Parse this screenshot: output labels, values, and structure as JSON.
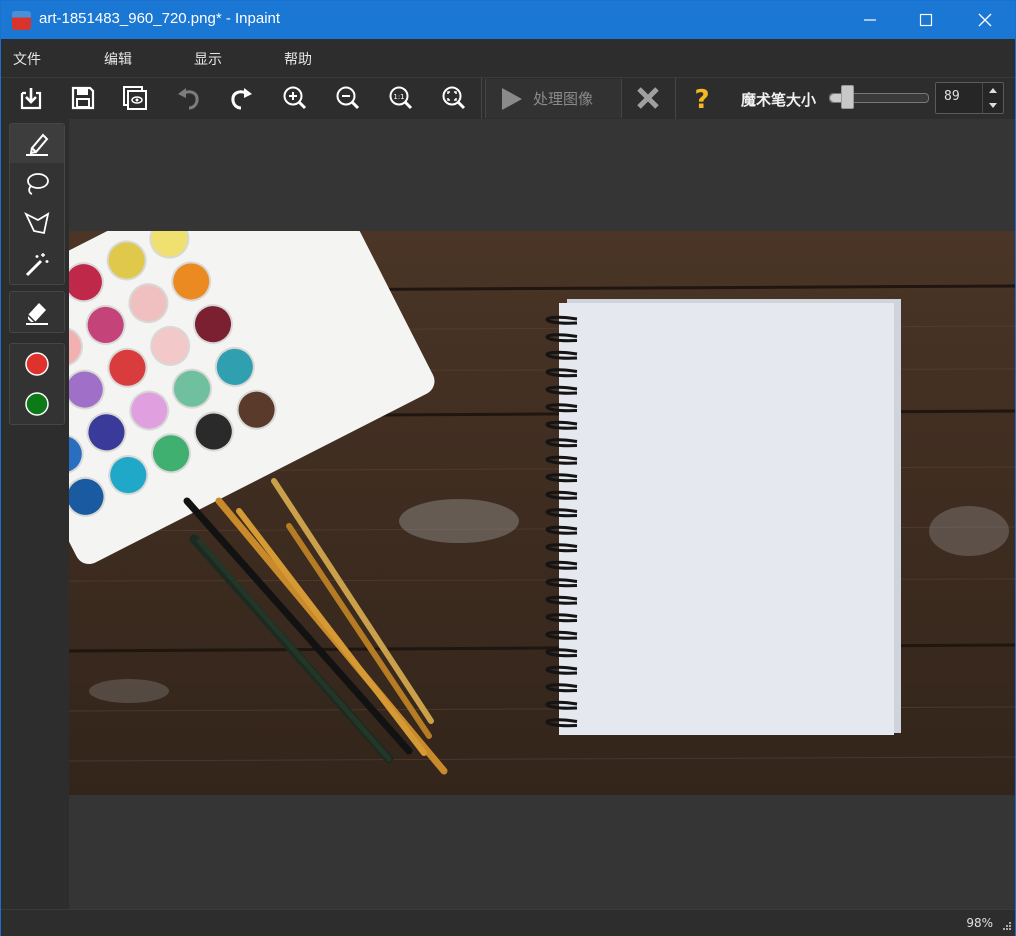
{
  "window": {
    "title": "art-1851483_960_720.png* - Inpaint",
    "controls": [
      "minimize-icon",
      "maximize-icon",
      "close-icon"
    ]
  },
  "menu": {
    "items": [
      "文件",
      "编辑",
      "显示",
      "帮助"
    ]
  },
  "toolbar": {
    "buttons": [
      "open-icon",
      "save-icon",
      "preview-icon",
      "undo-icon",
      "redo-icon",
      "zoom-in-icon",
      "zoom-out-icon",
      "zoom-1-1-icon",
      "zoom-fit-icon"
    ],
    "zoom_actual_glyph": "1:1",
    "process_label": "处理图像",
    "magic_wand_label": "魔术笔大小",
    "magic_wand_size": "89",
    "slider_fraction": 0.18
  },
  "side_tools": {
    "tools": [
      "marker-icon",
      "lasso-icon",
      "polygon-lasso-icon",
      "magic-wand-icon",
      "eraser-icon",
      "red-marker",
      "green-marker"
    ],
    "colors": {
      "red_marker": "#e0322c",
      "green_marker": "#0c7a16",
      "accent": "#1a77d4"
    }
  },
  "status": {
    "zoom": "98%"
  },
  "image": {
    "description_icon": "image-canvas"
  }
}
